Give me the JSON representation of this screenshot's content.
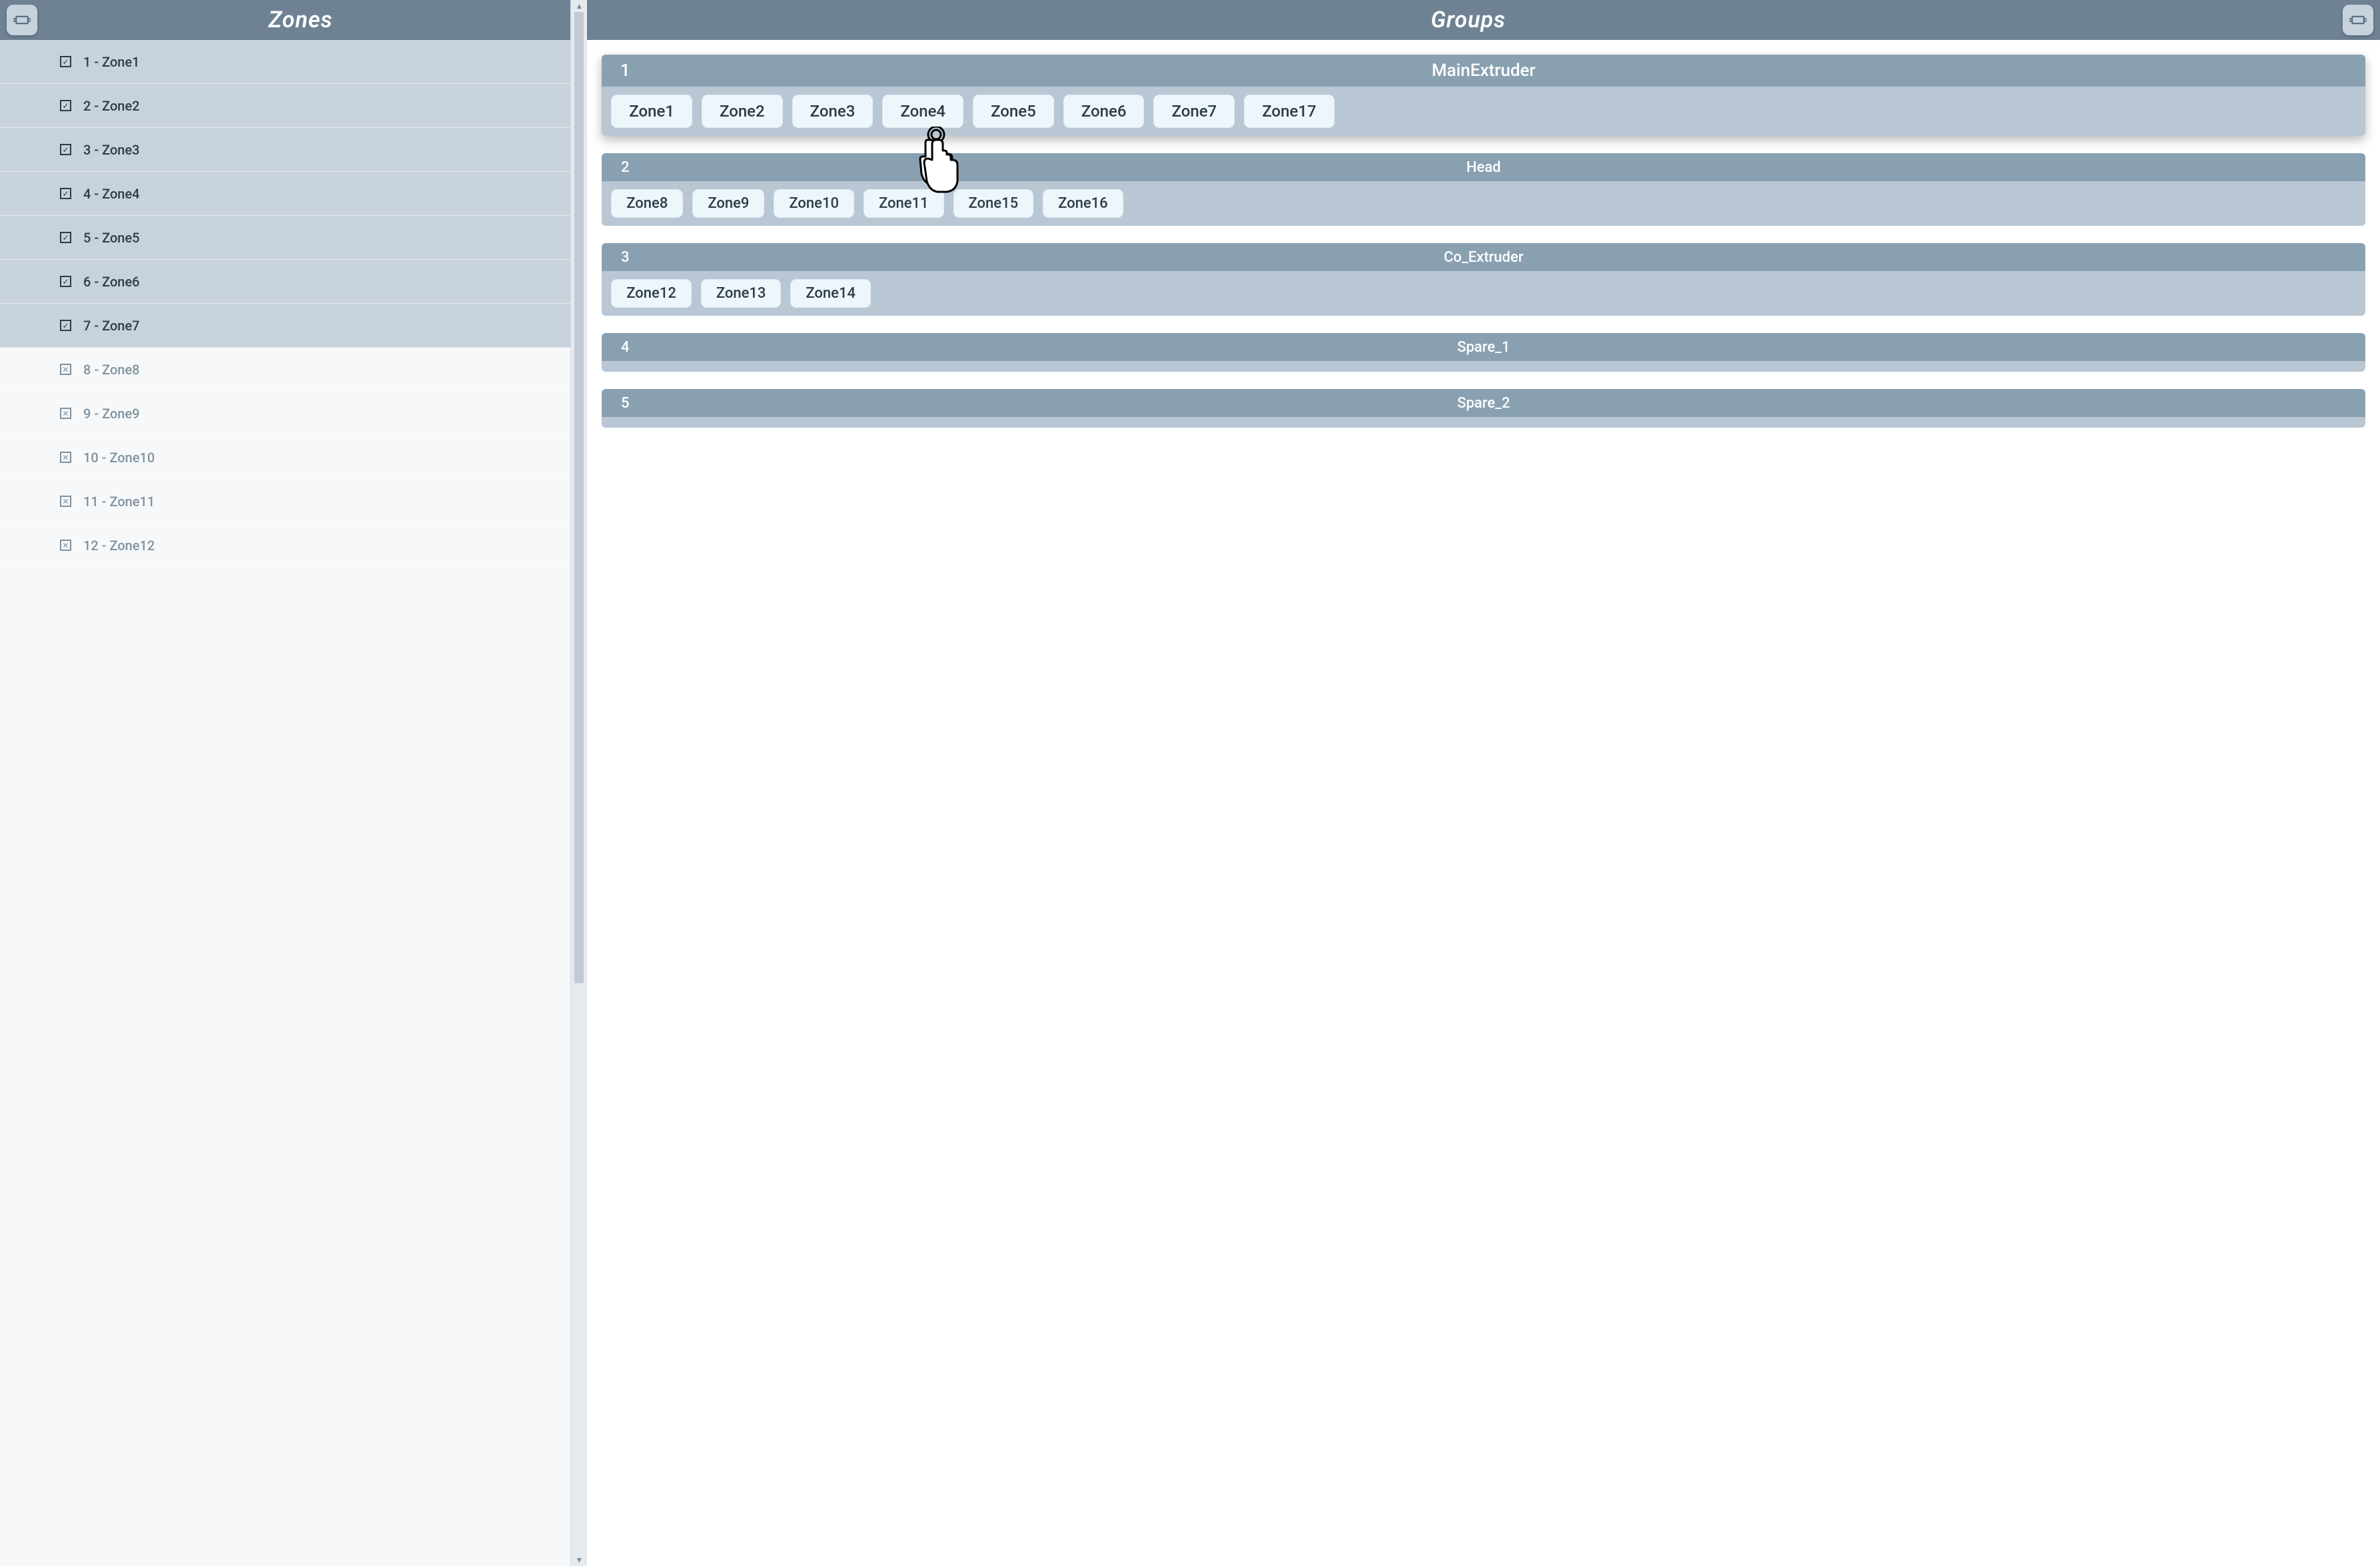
{
  "sidebar": {
    "title": "Zones",
    "items": [
      {
        "checked": true,
        "label": "1 - Zone1"
      },
      {
        "checked": true,
        "label": "2 - Zone2"
      },
      {
        "checked": true,
        "label": "3 - Zone3"
      },
      {
        "checked": true,
        "label": "4 - Zone4"
      },
      {
        "checked": true,
        "label": "5 - Zone5"
      },
      {
        "checked": true,
        "label": "6 - Zone6"
      },
      {
        "checked": true,
        "label": "7 - Zone7"
      },
      {
        "checked": false,
        "label": "8 - Zone8"
      },
      {
        "checked": false,
        "label": "9 - Zone9"
      },
      {
        "checked": false,
        "label": "10 - Zone10"
      },
      {
        "checked": false,
        "label": "11 - Zone11"
      },
      {
        "checked": false,
        "label": "12 - Zone12"
      }
    ]
  },
  "main": {
    "title": "Groups",
    "groups": [
      {
        "num": "1",
        "name": "MainExtruder",
        "active": true,
        "zones": [
          "Zone1",
          "Zone2",
          "Zone3",
          "Zone4",
          "Zone5",
          "Zone6",
          "Zone7",
          "Zone17"
        ]
      },
      {
        "num": "2",
        "name": "Head",
        "active": false,
        "zones": [
          "Zone8",
          "Zone9",
          "Zone10",
          "Zone11",
          "Zone15",
          "Zone16"
        ]
      },
      {
        "num": "3",
        "name": "Co_Extruder",
        "active": false,
        "zones": [
          "Zone12",
          "Zone13",
          "Zone14"
        ]
      },
      {
        "num": "4",
        "name": "Spare_1",
        "active": false,
        "zones": []
      },
      {
        "num": "5",
        "name": "Spare_2",
        "active": false,
        "zones": []
      }
    ]
  }
}
